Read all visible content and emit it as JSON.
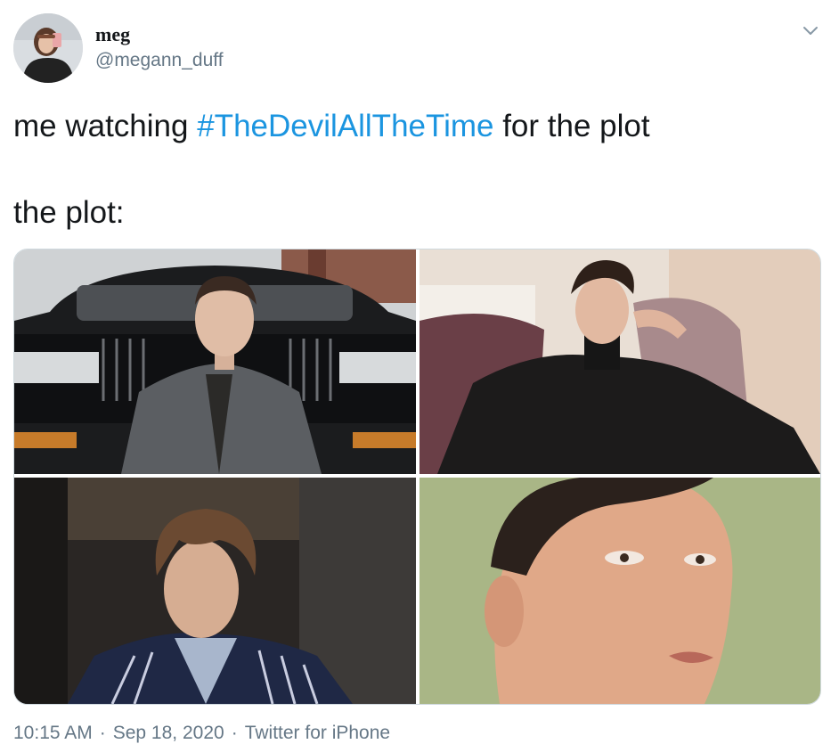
{
  "user": {
    "display_name": "meg",
    "handle": "@megann_duff"
  },
  "tweet": {
    "text_before_hashtag": "me watching ",
    "hashtag": "#TheDevilAllTheTime",
    "text_after_hashtag": " for the plot",
    "second_line": "the plot:"
  },
  "footer": {
    "time": "10:15 AM",
    "date": "Sep 18, 2020",
    "source": "Twitter for iPhone",
    "separator": "·"
  },
  "icons": {
    "menu": "chevron-down-icon"
  },
  "colors": {
    "hashtag": "#1b95e0",
    "secondary_text": "#657786",
    "primary_text": "#14171a",
    "border": "#cfd9de"
  }
}
